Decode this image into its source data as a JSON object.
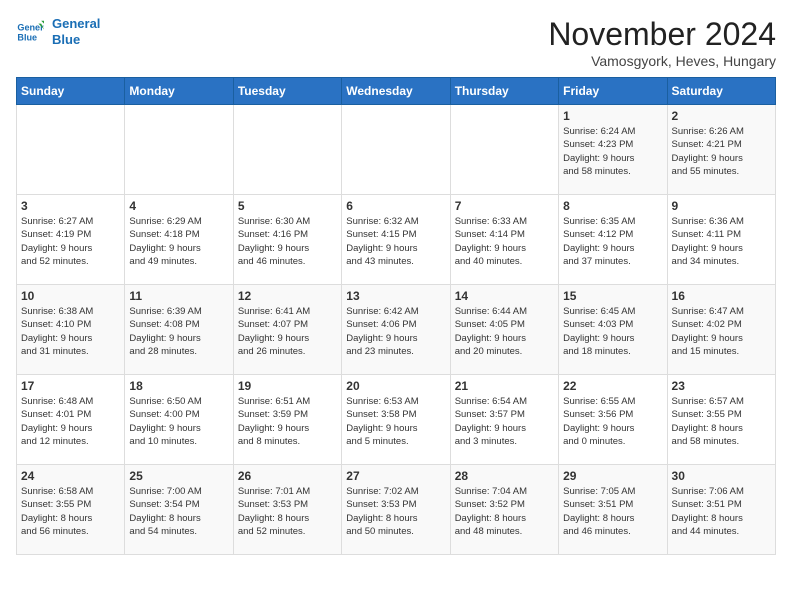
{
  "logo": {
    "line1": "General",
    "line2": "Blue"
  },
  "title": "November 2024",
  "subtitle": "Vamosgyork, Heves, Hungary",
  "days_header": [
    "Sunday",
    "Monday",
    "Tuesday",
    "Wednesday",
    "Thursday",
    "Friday",
    "Saturday"
  ],
  "weeks": [
    [
      {
        "num": "",
        "info": ""
      },
      {
        "num": "",
        "info": ""
      },
      {
        "num": "",
        "info": ""
      },
      {
        "num": "",
        "info": ""
      },
      {
        "num": "",
        "info": ""
      },
      {
        "num": "1",
        "info": "Sunrise: 6:24 AM\nSunset: 4:23 PM\nDaylight: 9 hours\nand 58 minutes."
      },
      {
        "num": "2",
        "info": "Sunrise: 6:26 AM\nSunset: 4:21 PM\nDaylight: 9 hours\nand 55 minutes."
      }
    ],
    [
      {
        "num": "3",
        "info": "Sunrise: 6:27 AM\nSunset: 4:19 PM\nDaylight: 9 hours\nand 52 minutes."
      },
      {
        "num": "4",
        "info": "Sunrise: 6:29 AM\nSunset: 4:18 PM\nDaylight: 9 hours\nand 49 minutes."
      },
      {
        "num": "5",
        "info": "Sunrise: 6:30 AM\nSunset: 4:16 PM\nDaylight: 9 hours\nand 46 minutes."
      },
      {
        "num": "6",
        "info": "Sunrise: 6:32 AM\nSunset: 4:15 PM\nDaylight: 9 hours\nand 43 minutes."
      },
      {
        "num": "7",
        "info": "Sunrise: 6:33 AM\nSunset: 4:14 PM\nDaylight: 9 hours\nand 40 minutes."
      },
      {
        "num": "8",
        "info": "Sunrise: 6:35 AM\nSunset: 4:12 PM\nDaylight: 9 hours\nand 37 minutes."
      },
      {
        "num": "9",
        "info": "Sunrise: 6:36 AM\nSunset: 4:11 PM\nDaylight: 9 hours\nand 34 minutes."
      }
    ],
    [
      {
        "num": "10",
        "info": "Sunrise: 6:38 AM\nSunset: 4:10 PM\nDaylight: 9 hours\nand 31 minutes."
      },
      {
        "num": "11",
        "info": "Sunrise: 6:39 AM\nSunset: 4:08 PM\nDaylight: 9 hours\nand 28 minutes."
      },
      {
        "num": "12",
        "info": "Sunrise: 6:41 AM\nSunset: 4:07 PM\nDaylight: 9 hours\nand 26 minutes."
      },
      {
        "num": "13",
        "info": "Sunrise: 6:42 AM\nSunset: 4:06 PM\nDaylight: 9 hours\nand 23 minutes."
      },
      {
        "num": "14",
        "info": "Sunrise: 6:44 AM\nSunset: 4:05 PM\nDaylight: 9 hours\nand 20 minutes."
      },
      {
        "num": "15",
        "info": "Sunrise: 6:45 AM\nSunset: 4:03 PM\nDaylight: 9 hours\nand 18 minutes."
      },
      {
        "num": "16",
        "info": "Sunrise: 6:47 AM\nSunset: 4:02 PM\nDaylight: 9 hours\nand 15 minutes."
      }
    ],
    [
      {
        "num": "17",
        "info": "Sunrise: 6:48 AM\nSunset: 4:01 PM\nDaylight: 9 hours\nand 12 minutes."
      },
      {
        "num": "18",
        "info": "Sunrise: 6:50 AM\nSunset: 4:00 PM\nDaylight: 9 hours\nand 10 minutes."
      },
      {
        "num": "19",
        "info": "Sunrise: 6:51 AM\nSunset: 3:59 PM\nDaylight: 9 hours\nand 8 minutes."
      },
      {
        "num": "20",
        "info": "Sunrise: 6:53 AM\nSunset: 3:58 PM\nDaylight: 9 hours\nand 5 minutes."
      },
      {
        "num": "21",
        "info": "Sunrise: 6:54 AM\nSunset: 3:57 PM\nDaylight: 9 hours\nand 3 minutes."
      },
      {
        "num": "22",
        "info": "Sunrise: 6:55 AM\nSunset: 3:56 PM\nDaylight: 9 hours\nand 0 minutes."
      },
      {
        "num": "23",
        "info": "Sunrise: 6:57 AM\nSunset: 3:55 PM\nDaylight: 8 hours\nand 58 minutes."
      }
    ],
    [
      {
        "num": "24",
        "info": "Sunrise: 6:58 AM\nSunset: 3:55 PM\nDaylight: 8 hours\nand 56 minutes."
      },
      {
        "num": "25",
        "info": "Sunrise: 7:00 AM\nSunset: 3:54 PM\nDaylight: 8 hours\nand 54 minutes."
      },
      {
        "num": "26",
        "info": "Sunrise: 7:01 AM\nSunset: 3:53 PM\nDaylight: 8 hours\nand 52 minutes."
      },
      {
        "num": "27",
        "info": "Sunrise: 7:02 AM\nSunset: 3:53 PM\nDaylight: 8 hours\nand 50 minutes."
      },
      {
        "num": "28",
        "info": "Sunrise: 7:04 AM\nSunset: 3:52 PM\nDaylight: 8 hours\nand 48 minutes."
      },
      {
        "num": "29",
        "info": "Sunrise: 7:05 AM\nSunset: 3:51 PM\nDaylight: 8 hours\nand 46 minutes."
      },
      {
        "num": "30",
        "info": "Sunrise: 7:06 AM\nSunset: 3:51 PM\nDaylight: 8 hours\nand 44 minutes."
      }
    ]
  ]
}
